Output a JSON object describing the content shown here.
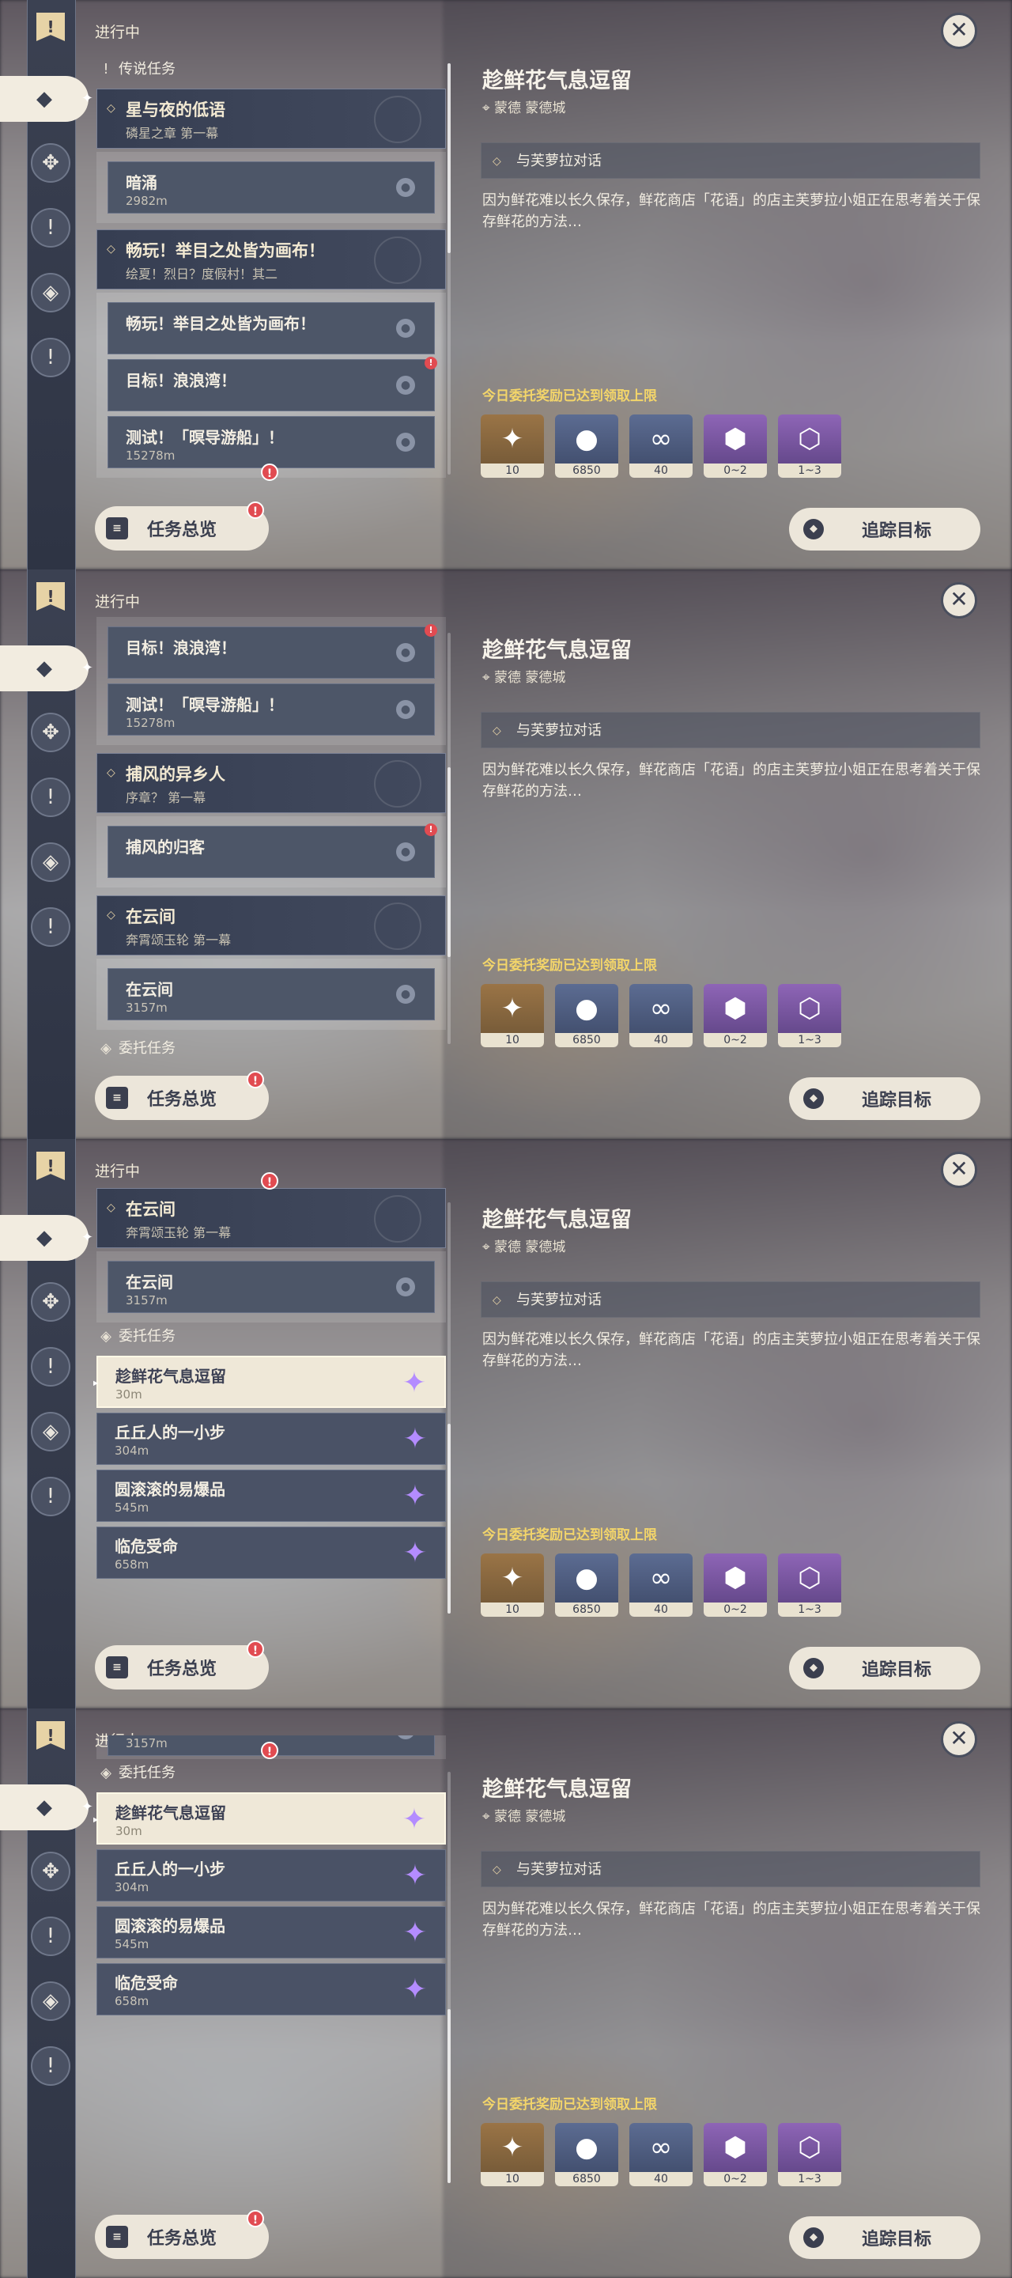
{
  "header": {
    "in_progress": "进行中"
  },
  "sections": {
    "legend": "传说任务",
    "commission": "委托任务"
  },
  "chapters": [
    {
      "title": "星与夜的低语",
      "sub": "磷星之章 第一幕"
    },
    {
      "title": "畅玩！举目之处皆为画布！",
      "sub": "绘夏！烈日？度假村！其二"
    },
    {
      "title": "捕风的异乡人",
      "sub": "序章？ 第一幕"
    },
    {
      "title": "在云间",
      "sub": "奔霄颂玉轮 第一幕"
    }
  ],
  "quests": [
    {
      "name": "暗涌",
      "dist": "2982m"
    },
    {
      "name": "畅玩！举目之处皆为画布！",
      "dist": ""
    },
    {
      "name": "目标！浪浪湾！",
      "dist": ""
    },
    {
      "name": "测试！「暝导游船」！",
      "dist": "15278m"
    },
    {
      "name": "捕风的归客",
      "dist": ""
    },
    {
      "name": "在云间",
      "dist": "3157m"
    }
  ],
  "commissions": [
    {
      "name": "趁鲜花气息逗留",
      "dist": "30m"
    },
    {
      "name": "丘丘人的一小步",
      "dist": "304m"
    },
    {
      "name": "圆滚滚的易爆品",
      "dist": "545m"
    },
    {
      "name": "临危受命",
      "dist": "658m"
    }
  ],
  "detail": {
    "title": "趁鲜花气息逗留",
    "location": "蒙德 蒙德城",
    "objective": "与芙萝拉对话",
    "description": "因为鲜花难以长久保存，鲜花商店「花语」的店主芙萝拉小姐正在思考着关于保存鲜花的方法…",
    "reward_note": "今日委托奖励已达到领取上限",
    "rewards": [
      "10",
      "6850",
      "40",
      "0~2",
      "1~3"
    ]
  },
  "buttons": {
    "overview": "任务总览",
    "track": "追踪目标"
  },
  "icons": {
    "close": "close-icon",
    "pin": "map-pin-icon",
    "alert": "alert-icon",
    "star": "commission-star-icon"
  },
  "colors": {
    "accent": "#e7d3a6",
    "alert": "#e14b51",
    "reward_note": "#f3d56a",
    "commission_star": "#b48cff"
  }
}
